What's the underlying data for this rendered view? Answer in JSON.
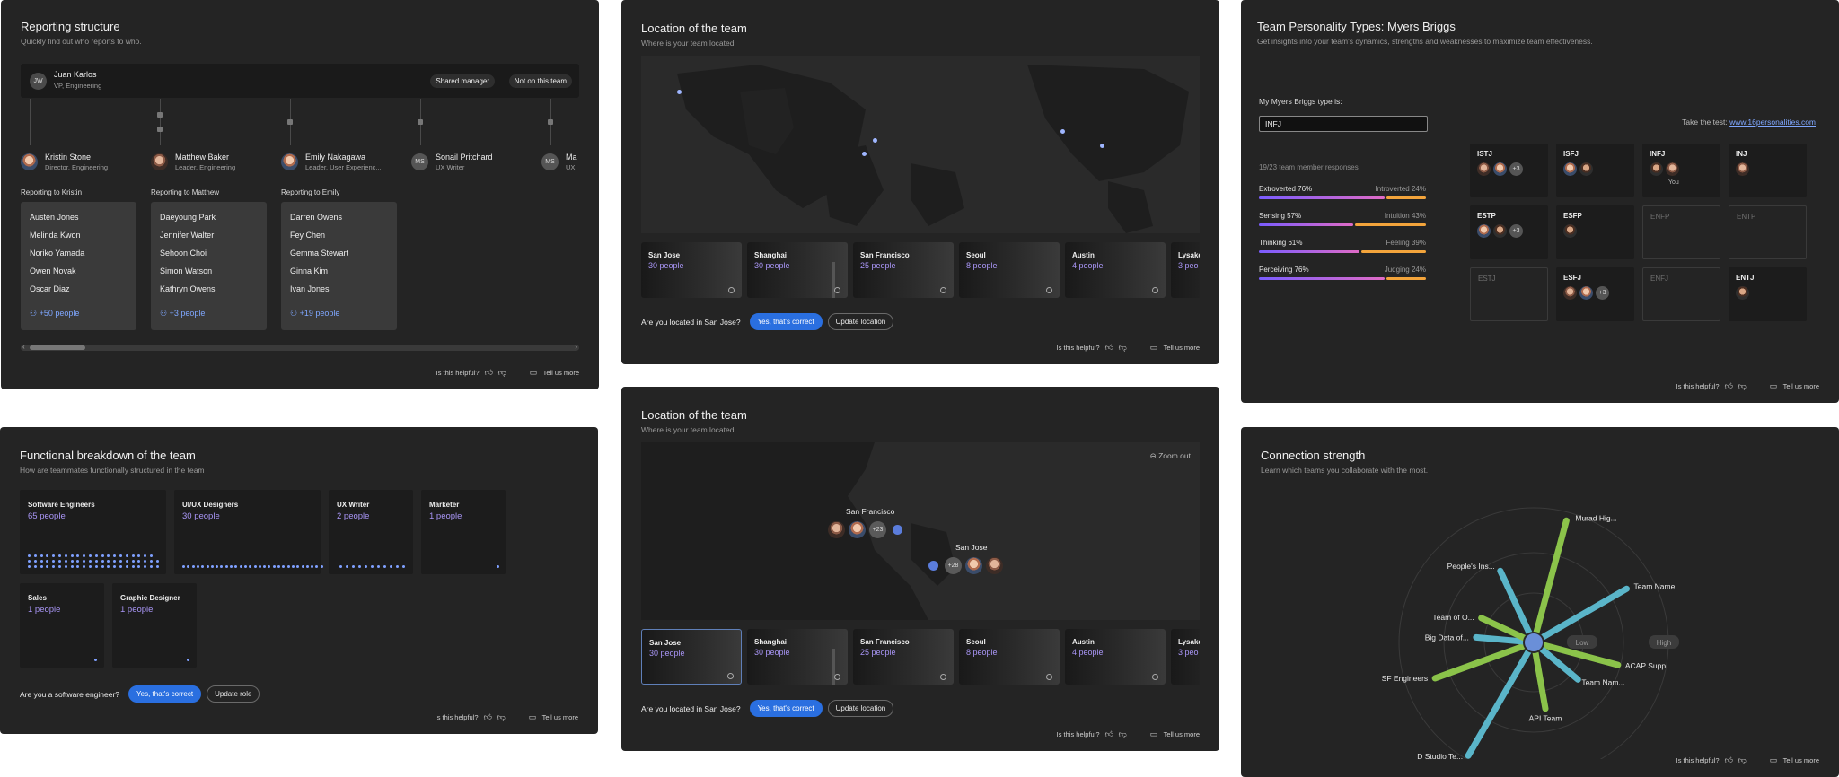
{
  "footer": {
    "helpful": "Is this helpful?",
    "tell": "Tell us more"
  },
  "reporting": {
    "title": "Reporting structure",
    "subtitle": "Quickly find out who reports to who.",
    "manager": {
      "initials": "JW",
      "name": "Juan Karlos",
      "role": "VP, Engineering"
    },
    "shared_manager": "Shared manager",
    "not_on_team": "Not on this team",
    "people": [
      {
        "name": "Kristin Stone",
        "role": "Director, Engineering"
      },
      {
        "name": "Matthew Baker",
        "role": "Leader, Engineering"
      },
      {
        "name": "Emily Nakagawa",
        "role": "Leader, User Experienc..."
      },
      {
        "name": "Sonail Pritchard",
        "role": "UX Writer",
        "initials": "MS"
      },
      {
        "name": "Ma",
        "role": "UX",
        "initials": "MS"
      }
    ],
    "groups": [
      {
        "label": "Reporting to Kristin",
        "members": [
          "Austen Jones",
          "Melinda Kwon",
          "Noriko Yamada",
          "Owen Novak",
          "Oscar Diaz"
        ],
        "more": "+50 people"
      },
      {
        "label": "Reporting to Matthew",
        "members": [
          "Daeyoung Park",
          "Jennifer Walter",
          "Sehoon Choi",
          "Simon Watson",
          "Kathryn Owens"
        ],
        "more": "+3 people"
      },
      {
        "label": "Reporting to Emily",
        "members": [
          "Darren Owens",
          "Fey Chen",
          "Gemma Stewart",
          "Ginna Kim",
          "Ivan Jones"
        ],
        "more": "+19 people"
      }
    ]
  },
  "location1": {
    "title": "Location of the team",
    "subtitle": "Where is your team located",
    "question": "Are you located in San Jose?",
    "yes": "Yes, that's correct",
    "update": "Update location",
    "cities": [
      {
        "name": "San Jose",
        "people": "30 people"
      },
      {
        "name": "Shanghai",
        "people": "30 people"
      },
      {
        "name": "San Francisco",
        "people": "25 people"
      },
      {
        "name": "Seoul",
        "people": "8 people"
      },
      {
        "name": "Austin",
        "people": "4 people"
      },
      {
        "name": "Lysake",
        "people": "3 peo"
      }
    ]
  },
  "location2": {
    "title": "Location of the team",
    "subtitle": "Where is your team located",
    "zoom_out": "Zoom out",
    "sf_label": "San Francisco",
    "sf_count": "+23",
    "sj_label": "San Jose",
    "sj_count": "+28",
    "question": "Are you located in San Jose?",
    "yes": "Yes, that's correct",
    "update": "Update location",
    "cities": [
      {
        "name": "San Jose",
        "people": "30 people"
      },
      {
        "name": "Shanghai",
        "people": "30 people"
      },
      {
        "name": "San Francisco",
        "people": "25 people"
      },
      {
        "name": "Seoul",
        "people": "8 people"
      },
      {
        "name": "Austin",
        "people": "4 people"
      },
      {
        "name": "Lysake",
        "people": "3 peo"
      }
    ]
  },
  "myers": {
    "title": "Team Personality Types: Myers Briggs",
    "subtitle": "Get insights into your team's dynamics, strengths and weaknesses to maximize team effectiveness.",
    "my_type_label": "My Myers Briggs type is:",
    "my_type_value": "INFJ",
    "take_test": "Take the test:",
    "test_link": "www.16personalities.com",
    "responses": "19/23 team member responses",
    "traits": [
      {
        "left": "Extroverted 76%",
        "right": "Introverted 24%",
        "pct": 76
      },
      {
        "left": "Sensing 57%",
        "right": "Intuition 43%",
        "pct": 57
      },
      {
        "left": "Thinking 61%",
        "right": "Feeling 39%",
        "pct": 61
      },
      {
        "left": "Perceiving 76%",
        "right": "Judging 24%",
        "pct": 76
      }
    ],
    "types": [
      {
        "code": "ISTJ",
        "avatars": 2,
        "more": "+3"
      },
      {
        "code": "ISFJ",
        "avatars": 2,
        "more": ""
      },
      {
        "code": "INFJ",
        "avatars": 2,
        "more": "",
        "you": "You"
      },
      {
        "code": "INJ",
        "avatars": 1,
        "more": ""
      },
      {
        "code": "ESTP",
        "avatars": 2,
        "more": "+3"
      },
      {
        "code": "ESFP",
        "avatars": 1,
        "more": ""
      },
      {
        "code": "ENFP",
        "avatars": 0,
        "more": ""
      },
      {
        "code": "ENTP",
        "avatars": 0,
        "more": ""
      },
      {
        "code": "ESTJ",
        "avatars": 0,
        "more": ""
      },
      {
        "code": "ESFJ",
        "avatars": 2,
        "more": "+3"
      },
      {
        "code": "ENFJ",
        "avatars": 0,
        "more": ""
      },
      {
        "code": "ENTJ",
        "avatars": 1,
        "more": ""
      }
    ]
  },
  "functional": {
    "title": "Functional breakdown of the team",
    "subtitle": "How are teammates functionally structured in the team",
    "roles": [
      {
        "title": "Software Engineers",
        "count": "65 people"
      },
      {
        "title": "UI/UX Designers",
        "count": "30 people"
      },
      {
        "title": "UX Writer",
        "count": "2 people"
      },
      {
        "title": "Marketer",
        "count": "1 people"
      },
      {
        "title": "Sales",
        "count": "1 people"
      },
      {
        "title": "Graphic Designer",
        "count": "1 people"
      }
    ],
    "question": "Are you a software engineer?",
    "yes": "Yes, that's correct",
    "update": "Update role"
  },
  "connection": {
    "title": "Connection strength",
    "subtitle": "Learn which teams you collaborate with the most.",
    "low": "Low",
    "high": "High",
    "teams": [
      {
        "label": "Murad Hig...",
        "strength": 0.88
      },
      {
        "label": "Team Name",
        "strength": 0.72
      },
      {
        "label": "ACAP Supp...",
        "strength": 0.55
      },
      {
        "label": "Team Nam...",
        "strength": 0.3
      },
      {
        "label": "API Team",
        "strength": 0.38
      },
      {
        "label": "D Studio Te...",
        "strength": 0.92
      },
      {
        "label": "SF Engineers",
        "strength": 0.7
      },
      {
        "label": "Big Data of...",
        "strength": 0.3
      },
      {
        "label": "Team of O...",
        "strength": 0.3
      },
      {
        "label": "People's Ins...",
        "strength": 0.48
      }
    ]
  }
}
